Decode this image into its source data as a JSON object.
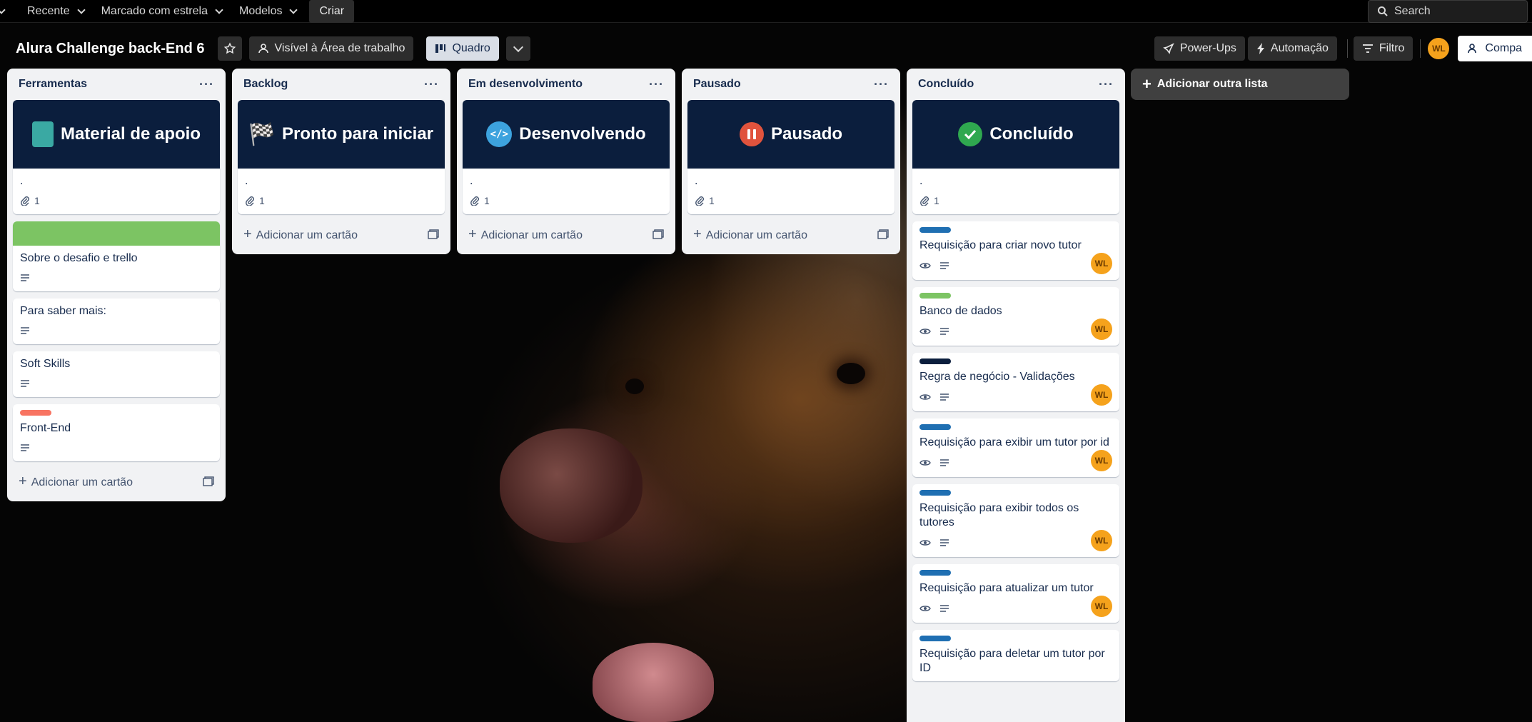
{
  "topbar": {
    "recent": "Recente",
    "starred": "Marcado com estrela",
    "templates": "Modelos",
    "create": "Criar",
    "search_placeholder": "Search"
  },
  "board": {
    "title": "Alura Challenge back-End 6",
    "visibility": "Visível à Área de trabalho",
    "view": "Quadro",
    "powerups": "Power-Ups",
    "automation": "Automação",
    "filter": "Filtro",
    "avatar": "WL",
    "share": "Compa"
  },
  "lists": [
    {
      "title": "Ferramentas",
      "cover": {
        "title": "Material de apoio",
        "icon": "notebook-icon"
      },
      "cover_card_text": ".",
      "cover_card_attachments": "1",
      "cards": [
        {
          "title": "Sobre o desafio e trello",
          "label_color": "#7cc463"
        },
        {
          "title": "Para saber mais:"
        },
        {
          "title": "Soft Skills"
        },
        {
          "title": "Front-End",
          "label_color": "#f87462"
        }
      ],
      "add_card": "Adicionar um cartão"
    },
    {
      "title": "Backlog",
      "cover": {
        "title": "Pronto para iniciar",
        "icon": "checkered-flag-icon"
      },
      "cover_card_text": ".",
      "cover_card_attachments": "1",
      "add_card": "Adicionar um cartão"
    },
    {
      "title": "Em desenvolvimento",
      "cover": {
        "title": "Desenvolvendo",
        "icon": "code-monitor-icon"
      },
      "cover_card_text": ".",
      "cover_card_attachments": "1",
      "add_card": "Adicionar um cartão"
    },
    {
      "title": "Pausado",
      "cover": {
        "title": "Pausado",
        "icon": "pause-icon"
      },
      "cover_card_text": ".",
      "cover_card_attachments": "1",
      "add_card": "Adicionar um cartão"
    },
    {
      "title": "Concluído",
      "cover": {
        "title": "Concluído",
        "icon": "check-icon"
      },
      "cover_card_text": ".",
      "cover_card_attachments": "1",
      "cards": [
        {
          "title": "Requisição para criar novo tutor",
          "label_color": "#1f6fb2",
          "member": "WL"
        },
        {
          "title": "Banco de dados",
          "label_color": "#7cc463",
          "member": "WL"
        },
        {
          "title": "Regra de negócio - Validações",
          "label_color": "#0b1e3d",
          "member": "WL"
        },
        {
          "title": "Requisição para exibir um tutor por id",
          "label_color": "#1f6fb2",
          "member": "WL"
        },
        {
          "title": "Requisição para exibir todos os tutores",
          "label_color": "#1f6fb2",
          "member": "WL"
        },
        {
          "title": "Requisição para atualizar um tutor",
          "label_color": "#1f6fb2",
          "member": "WL"
        },
        {
          "title": "Requisição para deletar um tutor por ID",
          "label_color": "#1f6fb2"
        }
      ]
    }
  ],
  "add_list": "Adicionar outra lista",
  "colors": {
    "cover_bg": "#0b1e3d",
    "list_bg": "#f1f2f4",
    "avatar": "#f5a21c",
    "label_green": "#7cc463",
    "label_blue": "#1f6fb2",
    "label_red": "#f87462",
    "label_navy": "#0b1e3d"
  }
}
